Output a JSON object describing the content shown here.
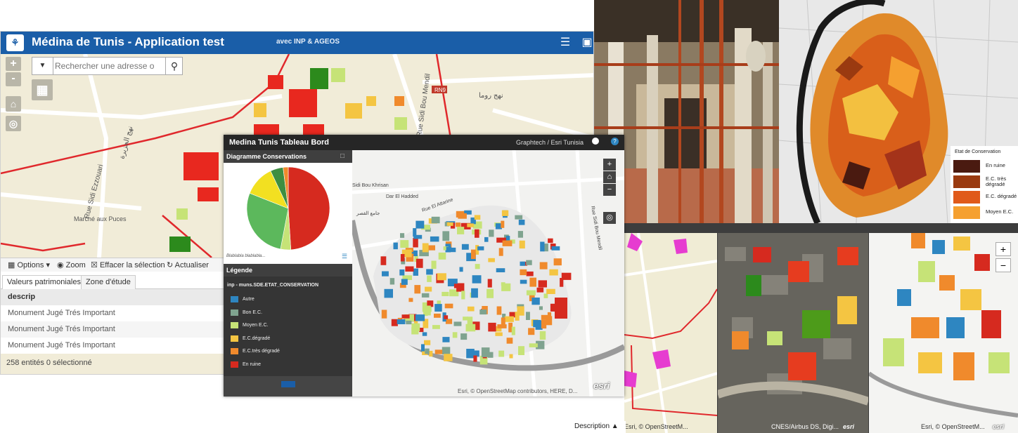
{
  "main_app": {
    "title": "Médina de Tunis - Application test",
    "subtitle": "avec INP & AGEOS",
    "search_placeholder": "Rechercher une adresse o",
    "zoom_in": "+",
    "zoom_out": "-",
    "map_labels": {
      "rue_sidi_ezzouari": "Rue Sidi Ezzouari",
      "rue_sidi_bou_mendil": "Rue Sidi Bou Mendil",
      "marche_aux_puces": "Marché aux Puces",
      "arabic_label_1": "نهج روما",
      "arabic_label_2": "نهج الجزيرة",
      "road_number": "RN9"
    },
    "toolbar": {
      "options": "Options",
      "zoom": "Zoom",
      "clear_selection": "Effacer la sélection",
      "refresh": "Actualiser"
    },
    "tabs": [
      "Valeurs patrimoniales",
      "Zone d'étude"
    ],
    "table": {
      "header": "descrip",
      "rows": [
        "Monument Jugé Trés Important",
        "Monument Jugé Trés Important",
        "Monument Jugé Trés Important"
      ]
    },
    "status": "258 entités 0 sélectionné"
  },
  "dashboard": {
    "title": "Medina Tunis Tableau Bord",
    "credit": "Graphtech / Esri Tunisia",
    "chart_panel_title": "Diagramme Conservations",
    "chart_note": "Blablabla blablabla...",
    "legend_title": "Légende",
    "legend_layer": "inp - muns.SDE.ETAT_CONSERVATION",
    "legend_items": [
      {
        "label": "Autre",
        "color": "#2e86c1"
      },
      {
        "label": "Bon E.C.",
        "color": "#7fa38f"
      },
      {
        "label": "Moyen E.C.",
        "color": "#c6e377"
      },
      {
        "label": "E.C.dégradé",
        "color": "#f4c542"
      },
      {
        "label": "E.C.très dégradé",
        "color": "#f08a2c"
      },
      {
        "label": "En ruine",
        "color": "#d62a1f"
      }
    ],
    "map_labels": {
      "sidi_bou_khrisan": "Sidi Bou Khrisan",
      "dar_el_hadded": "Dar El Hadded",
      "rue_el_attarine": "Rue El Attarine",
      "rue_sidi_bou_mendil": "Rue Sidi Bou Mendil",
      "jamaa": "جامع القصر"
    },
    "attribution": "Esri, © OpenStreetMap contributors, HERE, D...",
    "esri": "esri"
  },
  "chart_data": {
    "type": "pie",
    "title": "Diagramme Conservations",
    "slices": [
      {
        "label": "En ruine",
        "value": 49,
        "color": "#d62a1f"
      },
      {
        "label": "Moyen E.C.",
        "value": 4,
        "color": "#c6e377"
      },
      {
        "label": "Bon E.C.",
        "value": 28,
        "color": "#5cb85c"
      },
      {
        "label": "E.C.dégradé",
        "value": 12,
        "color": "#f2e021"
      },
      {
        "label": "Autre",
        "value": 5,
        "color": "#3e8e41"
      },
      {
        "label": "E.C.très dégradé",
        "value": 2,
        "color": "#f08a2c"
      }
    ]
  },
  "etat_conservation_legend": {
    "title": "Etat de Conservation",
    "items": [
      {
        "label": "En ruine",
        "color": "#4a1a10"
      },
      {
        "label": "E.C. très dégradé",
        "color": "#9a3a10"
      },
      {
        "label": "E.C. dégradé",
        "color": "#e05a1a"
      },
      {
        "label": "Moyen E.C.",
        "color": "#f5a030"
      }
    ]
  },
  "bottom_panels": {
    "credit_osm_1": "Esri, © OpenStreetM...",
    "credit_sat": "CNES/Airbus DS, Digi...",
    "credit_osm_2": "Esri, © OpenStreetM...",
    "esri": "esri",
    "zoom_in": "+",
    "zoom_out": "−",
    "description": "Description ▲"
  }
}
